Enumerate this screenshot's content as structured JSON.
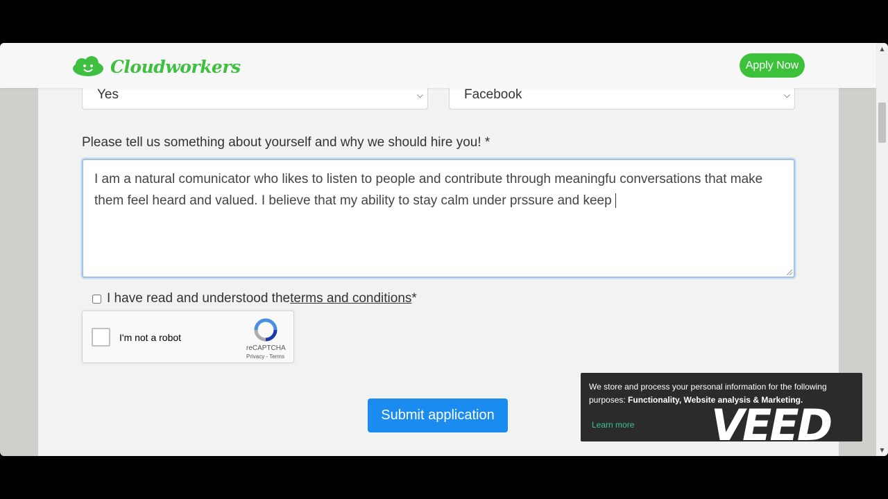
{
  "brand": {
    "name": "Cloudworkers",
    "color": "#3fbf3f"
  },
  "nav": {
    "apply_label": "Apply Now"
  },
  "form": {
    "select_1_value": "Yes",
    "select_2_value": "Facebook",
    "question_label": "Please tell us something about yourself and why we should hire you! *",
    "answer_text": "I am a natural comunicator who likes to listen to people and contribute through meaningfu conversations that make them feel heard and valued. I believe that my ability to stay calm under prssure and keep ",
    "terms_prefix": "I have read and understood the ",
    "terms_link": "terms and conditions",
    "terms_suffix": " *",
    "submit_label": "Submit application"
  },
  "recaptcha": {
    "label": "I'm not a robot",
    "brand": "reCAPTCHA",
    "links": "Privacy - Terms"
  },
  "cookie": {
    "text_prefix": "We store and process your personal information for the following purposes: ",
    "purposes": "Functionality, Website analysis & Marketing.",
    "learn_more": "Learn more"
  },
  "watermark": {
    "text": "VEED"
  }
}
